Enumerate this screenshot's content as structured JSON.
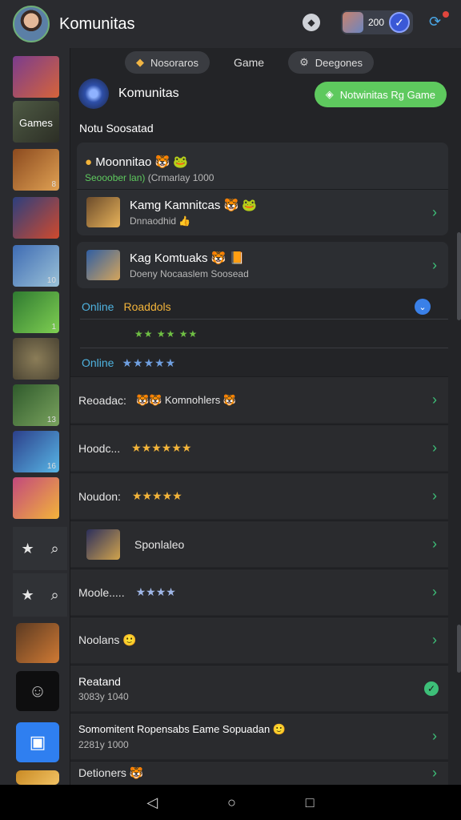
{
  "header": {
    "title": "Komunitas",
    "count": "200",
    "icons": [
      "compass-icon",
      "check-badge-icon",
      "notification-icon"
    ]
  },
  "sidebar": {
    "thumb_label": "Games",
    "thumb_numbers": [
      "1",
      "8",
      "10",
      "13",
      "16"
    ]
  },
  "tabs": {
    "left": "Nosoraros",
    "center": "Game",
    "right": "Deegones"
  },
  "community": {
    "name": "Komunitas",
    "button": "Notwinitas Rg Game"
  },
  "section_title": "Notu Soosatad",
  "featured": {
    "title": "Moonnitao 🐯 🐸",
    "subtitle_green": "Seooober lan)",
    "subtitle_rest": "(Crmarlay 1000",
    "row2_title": "Kamg Kamnitcas 🐯 🐸",
    "row2_sub": "Dnnaodhid 👍",
    "row3_title": "Kag Komtuaks 🐯 📙",
    "row3_sub": "Doeny Nocaaslem Soosead"
  },
  "online": {
    "online1": "Online",
    "label1": "Roaddols",
    "mid_stars": "★★ ★★ ★★",
    "online2": "Online",
    "stars2": "★★★★★"
  },
  "list": [
    {
      "label": "Reoadac:",
      "extra": "🐯🐯 Komnohlers 🐯"
    },
    {
      "label": "Hoodc...",
      "rating": "★★★★★★"
    },
    {
      "label": "Noudon:",
      "rating": "★★★★★"
    },
    {
      "label": "Sponlaleo"
    },
    {
      "label": "Moole.....",
      "rating": "★★★★"
    },
    {
      "label": "Noolans 🙂"
    },
    {
      "label": "Reatand",
      "sub": "3083y 1040"
    },
    {
      "label": "Somomitent Ropensabs Eame Sopuadan 🙂",
      "sub": "2281y 1000"
    },
    {
      "label": "Detioners 🐯"
    }
  ],
  "colors": {
    "accent_green": "#5ec95e",
    "online_blue": "#4fb3e0",
    "star": "#f3b43a"
  }
}
